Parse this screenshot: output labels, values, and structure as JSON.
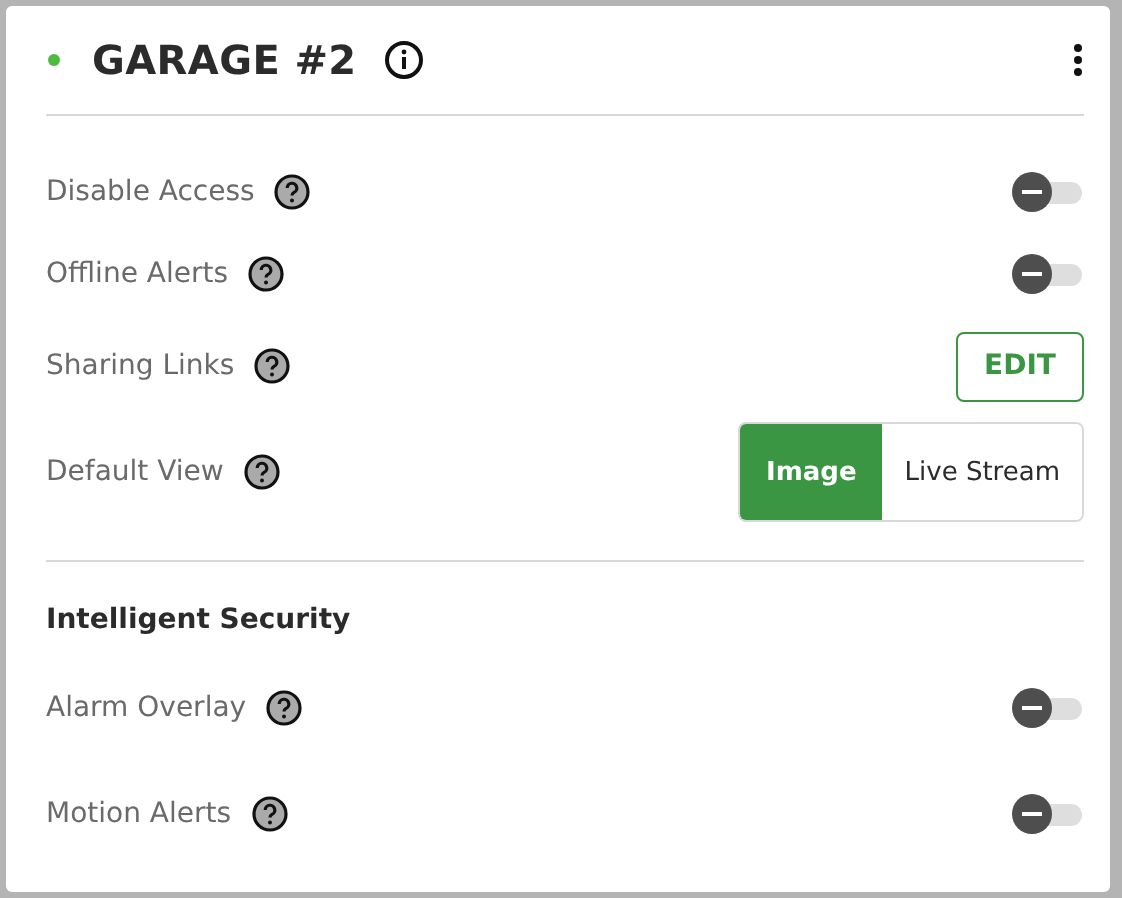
{
  "header": {
    "title": "GARAGE #2",
    "online": true
  },
  "settings": [
    {
      "kind": "toggle",
      "label": "Disable Access",
      "on": false
    },
    {
      "kind": "toggle",
      "label": "Offline Alerts",
      "on": false
    },
    {
      "kind": "button",
      "label": "Sharing Links",
      "button": "EDIT"
    },
    {
      "kind": "segmented",
      "label": "Default View",
      "options": [
        {
          "label": "Image",
          "selected": true
        },
        {
          "label": "Live Stream",
          "selected": false
        }
      ]
    }
  ],
  "section": {
    "title": "Intelligent Security",
    "settings": [
      {
        "kind": "toggle",
        "label": "Alarm Overlay",
        "on": false
      },
      {
        "kind": "toggle",
        "label": "Motion Alerts",
        "on": false
      }
    ]
  }
}
